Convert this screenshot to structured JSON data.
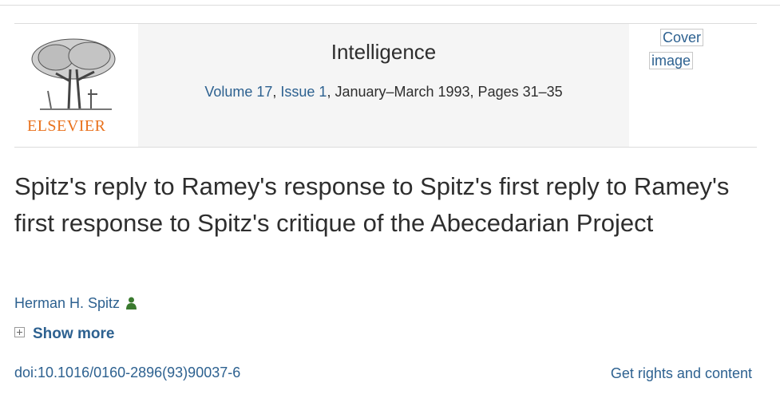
{
  "publisher": {
    "logo_word": "ELSEVIER"
  },
  "journal": {
    "title": "Intelligence",
    "volume": "Volume 17",
    "issue": "Issue 1",
    "date_pages": ", January–March 1993, Pages 31–35",
    "separator": ", "
  },
  "cover": {
    "line1": "Cover",
    "line2": "image"
  },
  "article": {
    "title": "Spitz's reply to Ramey's response to Spitz's first reply to Ramey's first response to Spitz's critique of the Abecedarian Project",
    "author": "Herman H. Spitz",
    "show_more": "Show more",
    "doi": "doi:10.1016/0160-2896(93)90037-6",
    "rights": "Get rights and content"
  },
  "colors": {
    "link": "#2d6190",
    "logo": "#e9711c",
    "person_icon": "#3a7a2e"
  },
  "icons": {
    "author": "person-icon",
    "expand": "plus-box-icon"
  }
}
